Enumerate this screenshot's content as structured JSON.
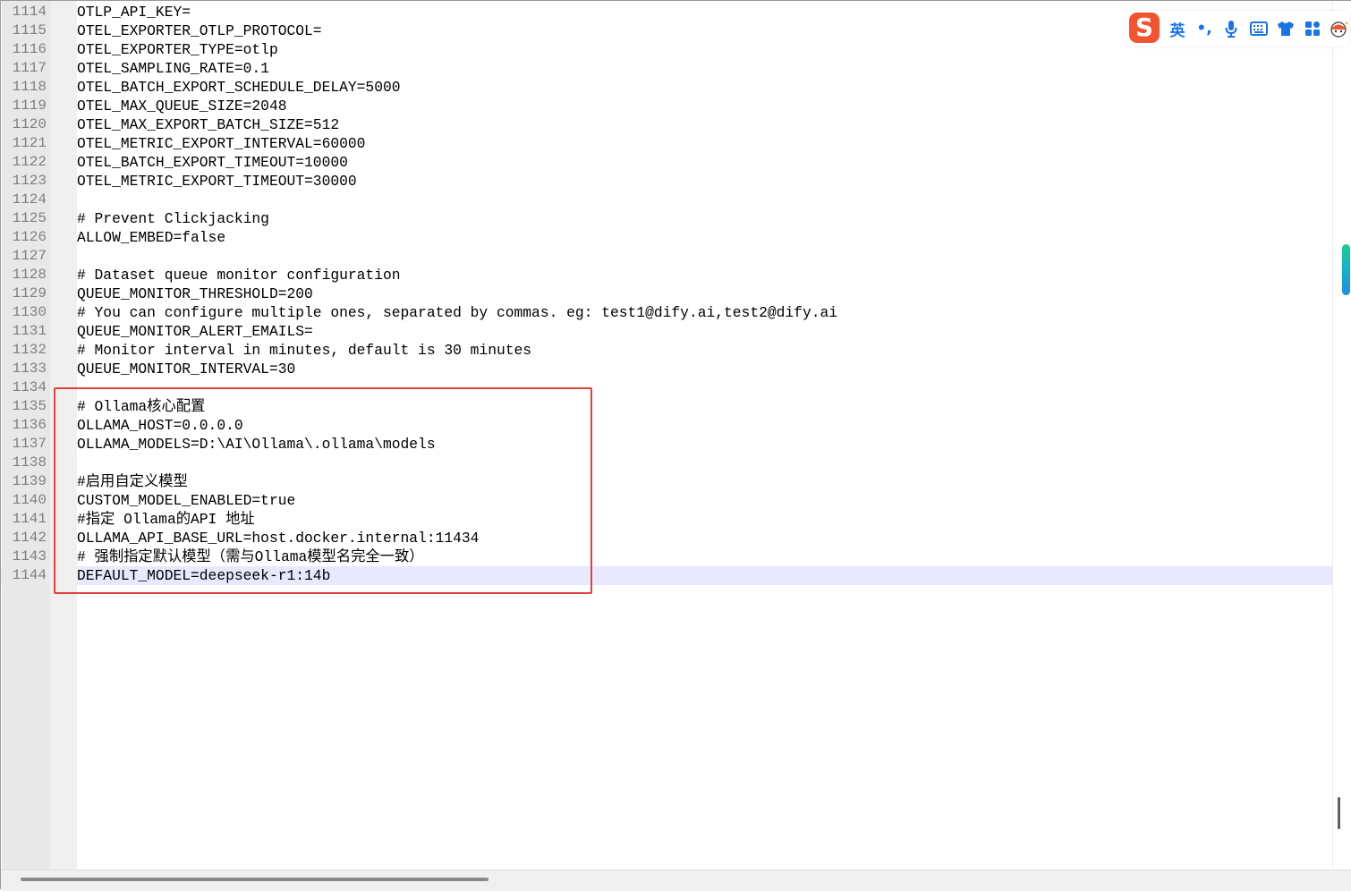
{
  "editor": {
    "lines": [
      {
        "number": "1114",
        "text": "OTLP_API_KEY="
      },
      {
        "number": "1115",
        "text": "OTEL_EXPORTER_OTLP_PROTOCOL="
      },
      {
        "number": "1116",
        "text": "OTEL_EXPORTER_TYPE=otlp"
      },
      {
        "number": "1117",
        "text": "OTEL_SAMPLING_RATE=0.1"
      },
      {
        "number": "1118",
        "text": "OTEL_BATCH_EXPORT_SCHEDULE_DELAY=5000"
      },
      {
        "number": "1119",
        "text": "OTEL_MAX_QUEUE_SIZE=2048"
      },
      {
        "number": "1120",
        "text": "OTEL_MAX_EXPORT_BATCH_SIZE=512"
      },
      {
        "number": "1121",
        "text": "OTEL_METRIC_EXPORT_INTERVAL=60000"
      },
      {
        "number": "1122",
        "text": "OTEL_BATCH_EXPORT_TIMEOUT=10000"
      },
      {
        "number": "1123",
        "text": "OTEL_METRIC_EXPORT_TIMEOUT=30000"
      },
      {
        "number": "1124",
        "text": ""
      },
      {
        "number": "1125",
        "text": "# Prevent Clickjacking"
      },
      {
        "number": "1126",
        "text": "ALLOW_EMBED=false"
      },
      {
        "number": "1127",
        "text": ""
      },
      {
        "number": "1128",
        "text": "# Dataset queue monitor configuration"
      },
      {
        "number": "1129",
        "text": "QUEUE_MONITOR_THRESHOLD=200"
      },
      {
        "number": "1130",
        "text": "# You can configure multiple ones, separated by commas. eg: test1@dify.ai,test2@dify.ai"
      },
      {
        "number": "1131",
        "text": "QUEUE_MONITOR_ALERT_EMAILS="
      },
      {
        "number": "1132",
        "text": "# Monitor interval in minutes, default is 30 minutes"
      },
      {
        "number": "1133",
        "text": "QUEUE_MONITOR_INTERVAL=30"
      },
      {
        "number": "1134",
        "text": ""
      },
      {
        "number": "1135",
        "text": "# Ollama核心配置"
      },
      {
        "number": "1136",
        "text": "OLLAMA_HOST=0.0.0.0"
      },
      {
        "number": "1137",
        "text": "OLLAMA_MODELS=D:\\AI\\Ollama\\.ollama\\models"
      },
      {
        "number": "1138",
        "text": ""
      },
      {
        "number": "1139",
        "text": "#启用自定义模型"
      },
      {
        "number": "1140",
        "text": "CUSTOM_MODEL_ENABLED=true"
      },
      {
        "number": "1141",
        "text": "#指定 Ollama的API 地址"
      },
      {
        "number": "1142",
        "text": "OLLAMA_API_BASE_URL=host.docker.internal:11434"
      },
      {
        "number": "1143",
        "text": "# 强制指定默认模型（需与Ollama模型名完全一致）"
      },
      {
        "number": "1144",
        "text": "DEFAULT_MODEL=deepseek-r1:14b",
        "current": true
      }
    ]
  },
  "ime_toolbar": {
    "logo_letter": "S",
    "language": "英",
    "punctuation": "•,",
    "icons": [
      "microphone-icon",
      "keyboard-icon",
      "skin-shirt-icon",
      "toolbox-grid-icon",
      "mascot-icon"
    ],
    "colors": {
      "logo": "#f0552f",
      "accent": "#1a73e8"
    }
  },
  "colors": {
    "highlight_box": "#e0413b",
    "current_line": "#e8e8ff",
    "line_number": "#808080",
    "gutter": "#e8e8e8"
  }
}
